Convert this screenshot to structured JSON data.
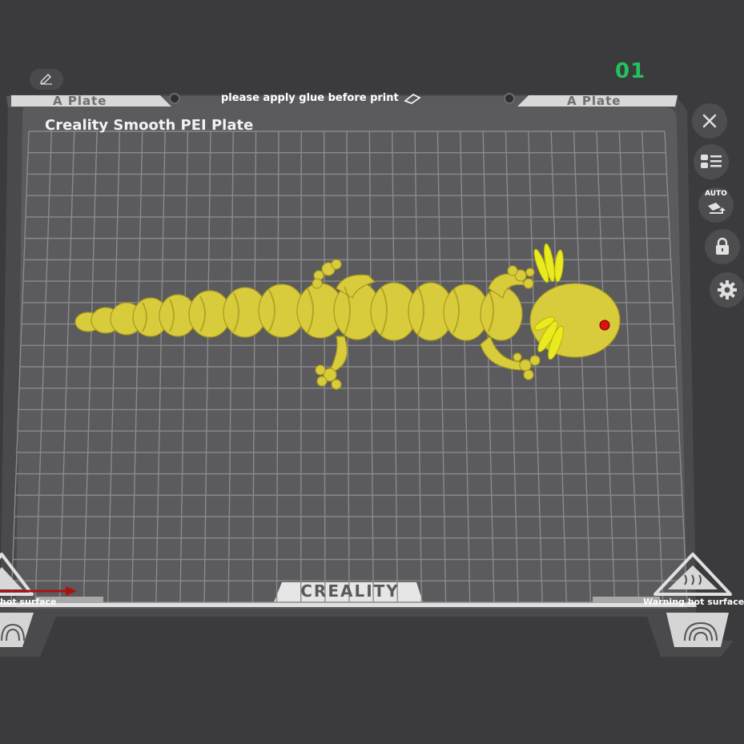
{
  "plate": {
    "number": "01",
    "title": "Creality Smooth PEI Plate",
    "tab_left": "A Plate",
    "tab_right": "A Plate",
    "notice": "please apply glue before print",
    "logo": "CREALITY",
    "warning_left": "hot surface",
    "warning_right": "Warning hot surface"
  },
  "toolbar": {
    "close_icon": "close-icon",
    "objects_icon": "object-list-icon",
    "auto_label": "AUTO",
    "auto_icon": "auto-arrange-icon",
    "lock_icon": "lock-icon",
    "settings_icon": "gear-icon"
  },
  "model": {
    "name": "axolotl",
    "color": "#d9cc3c",
    "highlight_color": "#e9eb1e",
    "eye_color": "#e01010"
  },
  "colors": {
    "background": "#3b3b3d",
    "plate": "#58585b",
    "plate_number": "#22c35e"
  }
}
